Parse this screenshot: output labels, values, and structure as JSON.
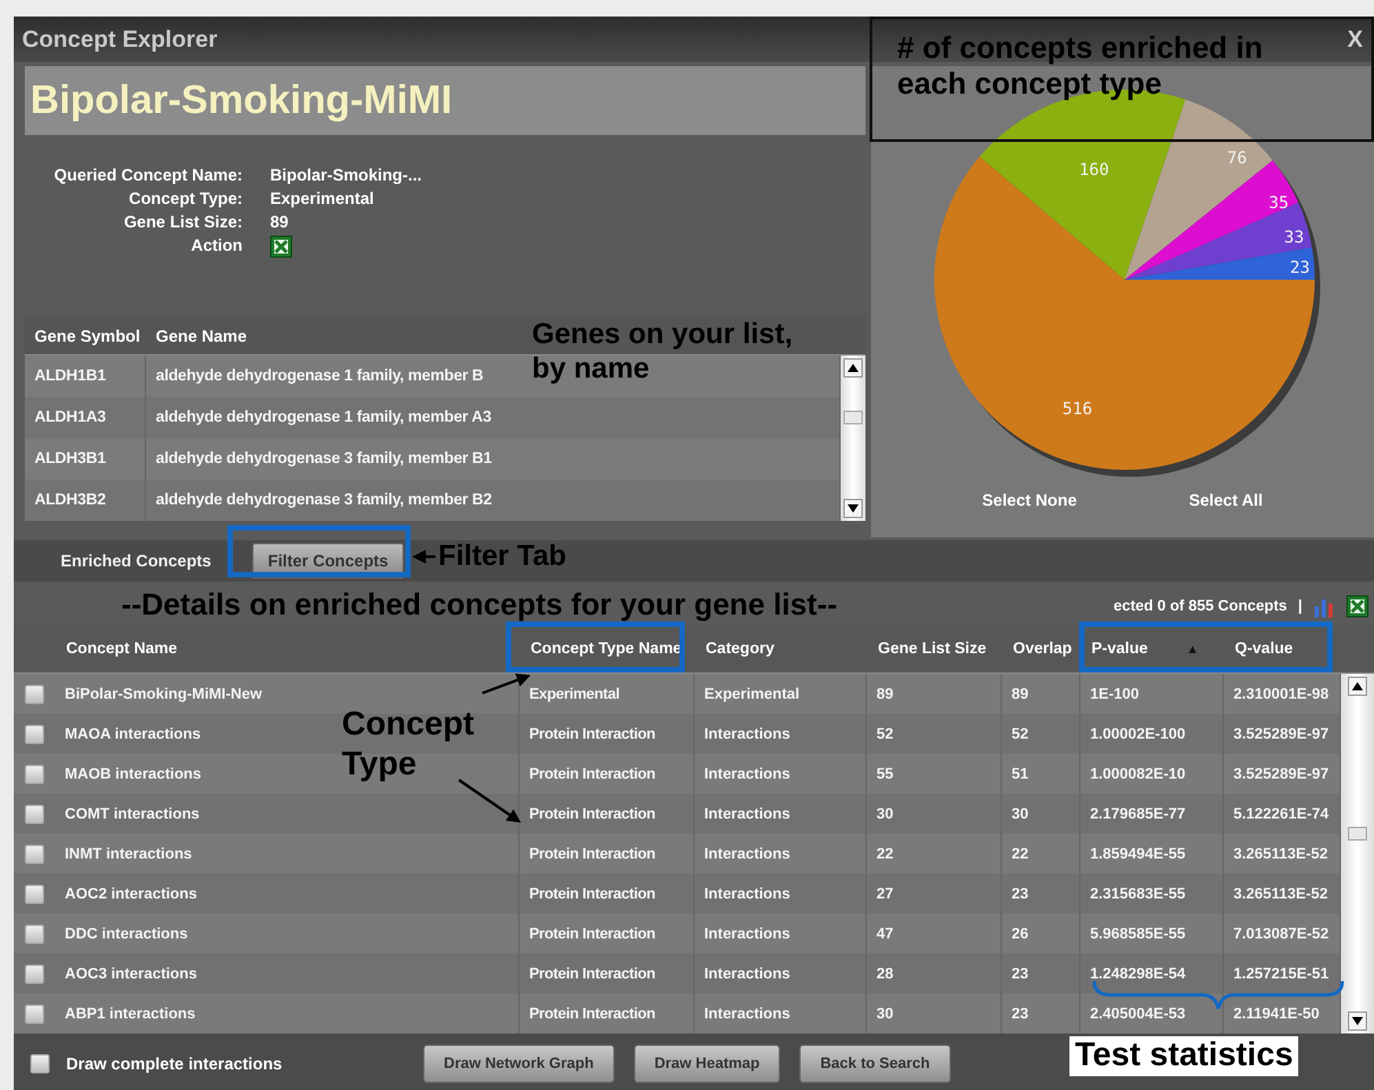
{
  "window": {
    "title": "Concept Explorer",
    "close": "X"
  },
  "concept_title": "Bipolar-Smoking-MiMI",
  "details": [
    {
      "label": "Queried Concept Name:",
      "value": "Bipolar-Smoking-..."
    },
    {
      "label": "Concept Type:",
      "value": "Experimental"
    },
    {
      "label": "Gene List Size:",
      "value": "89"
    },
    {
      "label": "Action",
      "kind": "excel"
    }
  ],
  "genes": {
    "columns": [
      "Gene Symbol",
      "Gene Name"
    ],
    "rows": [
      [
        "ALDH1B1",
        "aldehyde dehydrogenase 1 family, member B"
      ],
      [
        "ALDH1A3",
        "aldehyde dehydrogenase 1 family, member A3"
      ],
      [
        "ALDH3B1",
        "aldehyde dehydrogenase 3 family, member B1"
      ],
      [
        "ALDH3B2",
        "aldehyde dehydrogenase 3 family, member B2"
      ]
    ]
  },
  "pie": {
    "chart_data": {
      "type": "pie",
      "values": [
        516,
        160,
        76,
        35,
        33,
        23
      ],
      "colors": [
        "#cf7a1a",
        "#8bb00f",
        "#b4a391",
        "#dc0fd0",
        "#6f3fd0",
        "#2f63d8"
      ],
      "data_labels": true
    },
    "actions": [
      "Select None",
      "Select All"
    ]
  },
  "tabs": [
    {
      "label": "Enriched Concepts",
      "selected": true
    },
    {
      "label": "Filter Concepts",
      "selected": false
    }
  ],
  "selection_status": "ected 0 of 855 Concepts",
  "separator": "|",
  "concepts": {
    "columns": [
      {
        "label": "Concept Name"
      },
      {
        "label": "Concept Type Name"
      },
      {
        "label": "Category"
      },
      {
        "label": "Gene List Size"
      },
      {
        "label": "Overlap"
      },
      {
        "label": "P-value",
        "sort_mark": "▲"
      },
      {
        "label": "Q-value"
      }
    ],
    "rows": [
      {
        "checked": false,
        "cells": [
          "BiPolar-Smoking-MiMI-New",
          "Experimental",
          "Experimental",
          "89",
          "89",
          "1E-100",
          "2.310001E-98"
        ]
      },
      {
        "checked": false,
        "cells": [
          "MAOA interactions",
          "Protein Interaction",
          "Interactions",
          "52",
          "52",
          "1.00002E-100",
          "3.525289E-97"
        ]
      },
      {
        "checked": false,
        "cells": [
          "MAOB interactions",
          "Protein Interaction",
          "Interactions",
          "55",
          "51",
          "1.000082E-10",
          "3.525289E-97"
        ]
      },
      {
        "checked": false,
        "cells": [
          "COMT interactions",
          "Protein Interaction",
          "Interactions",
          "30",
          "30",
          "2.179685E-77",
          "5.122261E-74"
        ]
      },
      {
        "checked": false,
        "cells": [
          "INMT interactions",
          "Protein Interaction",
          "Interactions",
          "22",
          "22",
          "1.859494E-55",
          "3.265113E-52"
        ]
      },
      {
        "checked": false,
        "cells": [
          "AOC2 interactions",
          "Protein Interaction",
          "Interactions",
          "27",
          "23",
          "2.315683E-55",
          "3.265113E-52"
        ]
      },
      {
        "checked": false,
        "cells": [
          "DDC interactions",
          "Protein Interaction",
          "Interactions",
          "47",
          "26",
          "5.968585E-55",
          "7.013087E-52"
        ]
      },
      {
        "checked": false,
        "cells": [
          "AOC3 interactions",
          "Protein Interaction",
          "Interactions",
          "28",
          "23",
          "1.248298E-54",
          "1.257215E-51"
        ]
      },
      {
        "checked": false,
        "cells": [
          "ABP1 interactions",
          "Protein Interaction",
          "Interactions",
          "30",
          "23",
          "2.405004E-53",
          "2.11941E-50"
        ]
      }
    ]
  },
  "draw_complete_interactions": {
    "label": "Draw complete interactions",
    "checked": false
  },
  "buttons": [
    "Draw Network Graph",
    "Draw Heatmap",
    "Back to Search"
  ],
  "annotations": {
    "pie_caption": "# of concepts enriched in each concept type",
    "genes_caption": "Genes on your list, by name",
    "filter_caption": "Filter Tab",
    "details_caption": "--Details on enriched concepts for your gene list--",
    "concept_type_caption": "Concept Type",
    "stats_caption": "Test statistics"
  }
}
